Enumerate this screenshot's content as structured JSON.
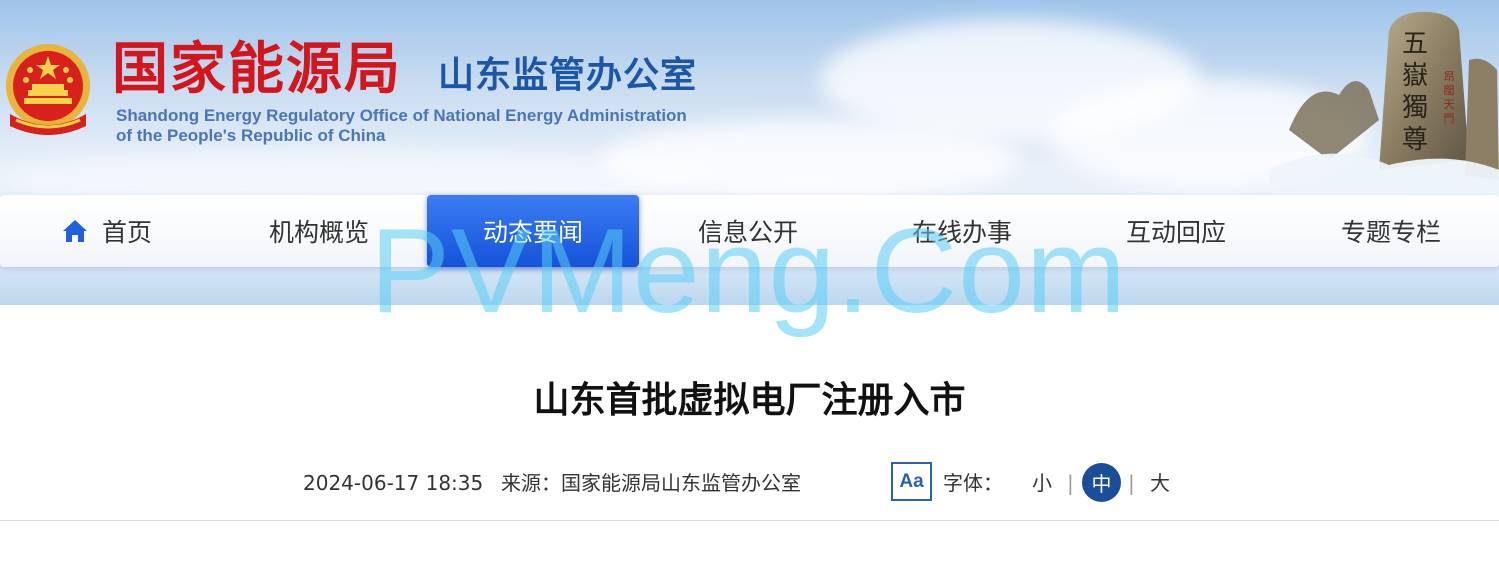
{
  "header": {
    "org_name": "国家能源局",
    "office_name": "山东监管办公室",
    "english_line_1": "Shandong Energy Regulatory Office of National Energy Administration",
    "english_line_2": "of the People's Republic of China",
    "mountain_inscription_main": "五嶽獨尊",
    "mountain_inscription_side": "昂闊天門",
    "emblem_icon": "national-emblem-icon",
    "colors": {
      "org_red": "#d4151b",
      "office_blue": "#1c56a6"
    }
  },
  "nav": {
    "items": [
      {
        "label": "首页",
        "icon": "home-icon"
      },
      {
        "label": "机构概览"
      },
      {
        "label": "动态要闻",
        "active": true
      },
      {
        "label": "信息公开"
      },
      {
        "label": "在线办事"
      },
      {
        "label": "互动回应"
      },
      {
        "label": "专题专栏"
      }
    ],
    "active_color": "#1f5fe0"
  },
  "watermark": "PVMeng.Com",
  "article": {
    "title": "山东首批虚拟电厂注册入市",
    "date": "2024-06-17 18:35",
    "source": "来源：国家能源局山东监管办公室",
    "font_size": {
      "icon_text": "Aa",
      "label": "字体：",
      "small": "小",
      "medium": "中",
      "large": "大",
      "separator": "|",
      "selected": "中"
    }
  }
}
